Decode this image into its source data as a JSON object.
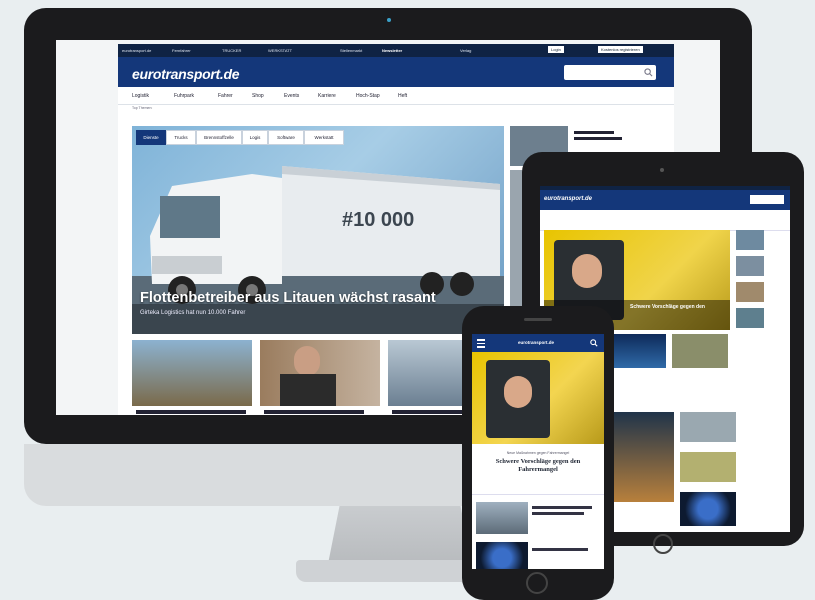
{
  "site": {
    "logo": "eurotransport.de",
    "topbar": [
      "eurotransport.de",
      "Fernfahrer",
      "TRUCKER",
      "WERKSTATT",
      "Stellenmarkt",
      "Newsletter",
      "Verlag",
      "Login",
      "Kostenlos registrieren"
    ],
    "nav": [
      "Logistik",
      "Fuhrpark",
      "Fahrer",
      "Shop",
      "Events",
      "Karriere",
      "Hoch-Stap",
      "Heft"
    ],
    "top_themen": "Top Themen:",
    "tabs": [
      "Dienste",
      "Trucks",
      "Brennstoffzelle",
      "Logis",
      "Software",
      "Werkstatt"
    ],
    "hero_headline": "Flottenbetreiber aus Litauen wächst rasant",
    "hero_subline": "Girteka Logistics hat nun 10.000 Fahrer",
    "truck_text": "#10 000"
  },
  "tablet": {
    "logo": "eurotransport.de",
    "hero_headline": "Schwere Vorschläge gegen den"
  },
  "phone": {
    "logo": "eurotransport.de",
    "kicker": "Neue Maßnahmen gegen Fahrermangel",
    "headline": "Schwere Vorschläge gegen den Fahrermangel"
  },
  "colors": {
    "brand_navy": "#14377a",
    "top_bar": "#0f2344",
    "device_frame": "#1b1b1d",
    "background": "#e9eef0"
  }
}
